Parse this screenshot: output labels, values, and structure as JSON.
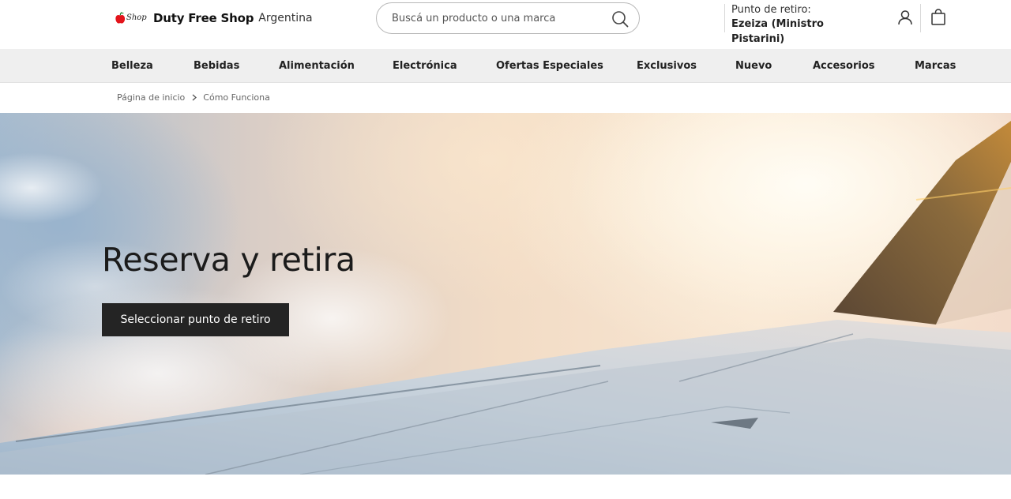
{
  "brand": {
    "mark_text": "Shop",
    "name": "Duty Free Shop",
    "country": "Argentina",
    "mark_color": "#e3141b"
  },
  "search": {
    "placeholder": "Buscá un producto o una marca",
    "value": "",
    "icon": "search-icon"
  },
  "pickup": {
    "label": "Punto de retiro:",
    "value": "Ezeiza (Ministro Pistarini)"
  },
  "header_icons": [
    "user-icon",
    "shopping-bag-icon"
  ],
  "nav": {
    "items": [
      {
        "label": "Belleza"
      },
      {
        "label": "Bebidas"
      },
      {
        "label": "Alimentación"
      },
      {
        "label": "Electrónica"
      },
      {
        "label": "Ofertas Especiales"
      },
      {
        "label": "Exclusivos"
      },
      {
        "label": "Nuevo"
      },
      {
        "label": "Accesorios"
      },
      {
        "label": "Marcas"
      }
    ]
  },
  "breadcrumb": {
    "home": "Página de inicio",
    "current": "Cómo Funciona"
  },
  "hero": {
    "title": "Reserva y retira",
    "cta_label": "Seleccionar punto de retiro"
  },
  "colors": {
    "nav_background": "#efefef",
    "cta_background": "#242424",
    "cta_text": "#ffffff"
  }
}
